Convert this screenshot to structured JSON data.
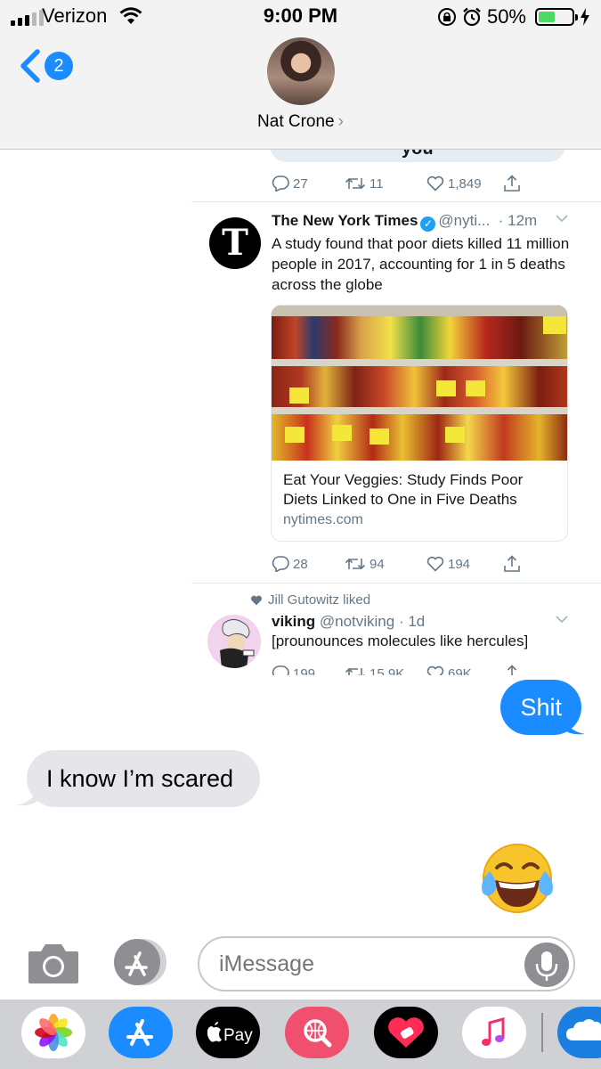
{
  "status_bar": {
    "carrier": "Verizon",
    "time": "9:00 PM",
    "battery": "50%",
    "battery_level": 0.5,
    "icons": [
      "signal-icon",
      "wifi-icon",
      "rotation-lock-icon",
      "alarm-icon",
      "battery-icon",
      "charging-icon"
    ]
  },
  "header": {
    "back_count": "2",
    "contact_name": "Nat Crone",
    "chevron": "›"
  },
  "tweets": {
    "partial_top": {
      "fragment": "you",
      "replies": "27",
      "retweets": "11",
      "likes": "1,849"
    },
    "nyt": {
      "avatar_letter": "T",
      "name": "The New York Times",
      "handle": "@nyti...",
      "time": "· 12m",
      "text": "A study found that poor diets killed 11 million people in 2017, accounting for 1 in 5 deaths across the globe",
      "card_title": "Eat Your Veggies: Study Finds Poor Diets Linked to One in Five Deaths",
      "card_domain": "nytimes.com",
      "replies": "28",
      "retweets": "94",
      "likes": "194"
    },
    "viking": {
      "liked_by": "Jill Gutowitz liked",
      "name": "viking",
      "handle": "@notviking",
      "time": "· 1d",
      "text": "[prounounces molecules like hercules]",
      "replies": "199",
      "retweets": "15.9K",
      "likes": "69K"
    }
  },
  "messages": {
    "outgoing": "Shit",
    "incoming": "I know I’m scared",
    "emoji": "😂"
  },
  "compose": {
    "placeholder": "iMessage"
  },
  "app_drawer": [
    "photos-app-icon",
    "app-store-icon",
    "apple-pay-icon",
    "search-images-icon",
    "heart-app-icon",
    "music-app-icon",
    "cloud-app-icon"
  ],
  "colors": {
    "imessage_blue": "#1a8cff",
    "incoming_gray": "#e5e5ea",
    "twitter_gray": "#657786",
    "verified_blue": "#1da1f2"
  }
}
